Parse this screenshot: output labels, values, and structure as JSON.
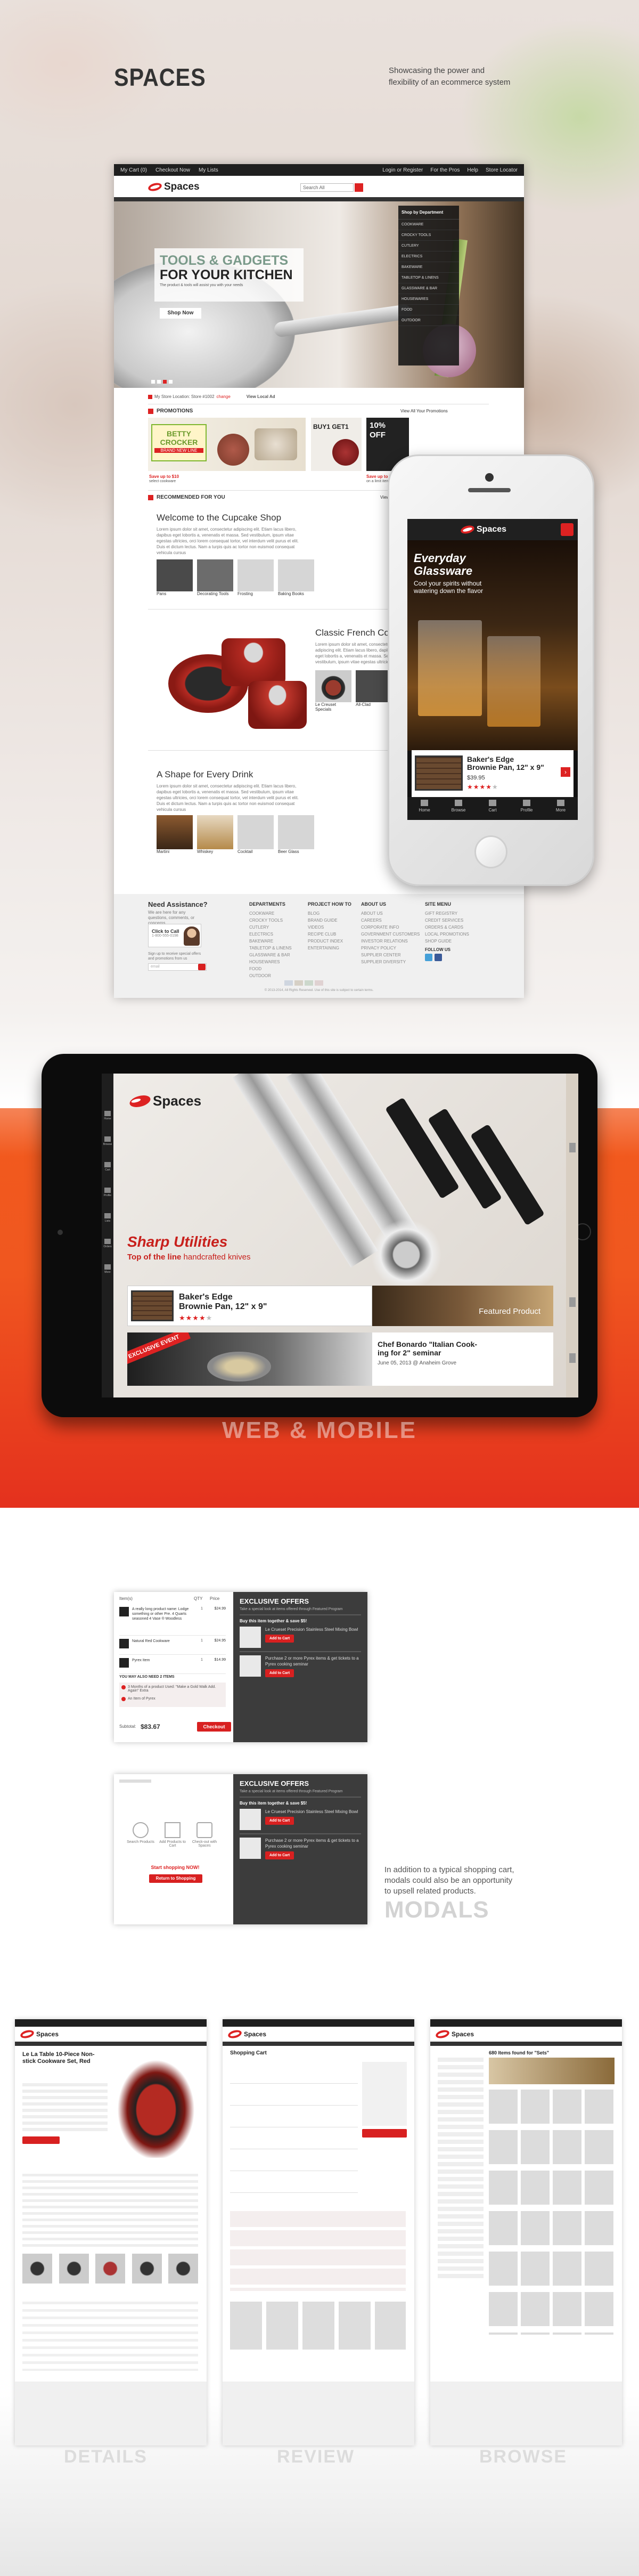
{
  "intro": {
    "title": "SPACES",
    "tagline_line1": "Showcasing the power and",
    "tagline_line2": "flexibility of an ecommerce system"
  },
  "desktop": {
    "top_nav": {
      "cart": "My Cart (0)",
      "checkout": "Checkout Now",
      "lists": "My Lists",
      "login": "Login or Register",
      "pros": "For the Pros",
      "help": "Help",
      "store": "Store Locator"
    },
    "logo": "Spaces",
    "search_placeholder": "Search All",
    "hero": {
      "heading_line1": "TOOLS & GADGETS",
      "heading_line2": "FOR YOUR KITCHEN",
      "subtext": "The product & tools will assist you with your needs",
      "button": "Shop Now"
    },
    "departments": {
      "header": "Shop by Department",
      "items": [
        "COOKWARE",
        "CROCKY TOOLS",
        "CUTLERY",
        "ELECTRICS",
        "BAKEWARE",
        "TABLETOP & LINENS",
        "GLASSWARE & BAR",
        "HOUSEWARES",
        "FOOD",
        "OUTDOOR"
      ]
    },
    "store_bar": {
      "text": "My Store Location: Store #1002",
      "change": "change",
      "local_ad": "View Local Ad"
    },
    "promotions": {
      "label": "PROMOTIONS",
      "view_all": "View All Your Promotions",
      "banner1_line1": "BETTY",
      "banner1_line2": "CROCKER",
      "banner1_line3": "BRAND NEW LINE",
      "banner2": "BUY1 GET1",
      "banner3_line1": "10%",
      "banner3_line2": "OFF",
      "save1_title": "Save up to $10",
      "save1_sub": "select cookware",
      "save2_title": "Save up to $20",
      "save2_sub": "on a limit item"
    },
    "recommended": {
      "label": "RECOMMENDED FOR YOU",
      "view": "View"
    },
    "cupcake": {
      "title": "Welcome to the Cupcake Shop",
      "body": "Lorem ipsum dolor sit amet, consectetur adipiscing elit. Etiam lacus libero, dapibus eget lobortis a, venenatis et massa. Sed vestibulum, ipsum vitae egestas ultricies, orci lorem consequat tortor, vel interdum velit purus et elit. Duis et dictum lectus. Nam a turpis quis ac tortor non euismod consequat vehicula cursus",
      "captions": [
        "Pans",
        "Decorating Tools",
        "Frosting",
        "Baking Books"
      ]
    },
    "french": {
      "title": "Classic French Co",
      "body": "Lorem ipsum dolor sit amet, consectetur adipiscing elit. Etiam lacus libero, dapibus eget lobortis a, venenatis et massa. Sed vestibulum, ipsum vitae egestas ultricies",
      "captions": [
        "Le Creuset Specials",
        "All-Clad"
      ]
    },
    "drink": {
      "title": "A Shape for Every Drink",
      "body": "Lorem ipsum dolor sit amet, consectetur adipiscing elit. Etiam lacus libero, dapibus eget lobortis a, venenatis et massa. Sed vestibulum, ipsum vitae egestas ultricies, orci lorem consequat tortor, vel interdum velit purus et elit. Duis et dictum lectus. Nam a turpis quis ac tortor non euismod consequat vehicula cursus",
      "captions": [
        "Martini",
        "Whiskey",
        "Cocktail",
        "Beer Glass"
      ]
    },
    "footer": {
      "assist_title": "Need Assistance?",
      "assist_text": "We are here for any questions, comments, or concerns",
      "call_label": "Click to Call",
      "call_number": "1-800-555-0198",
      "signup_text": "Sign up to receive special offers and promotions from us",
      "email_placeholder": "email",
      "columns": [
        {
          "title": "DEPARTMENTS",
          "items": [
            "COOKWARE",
            "CROCKY TOOLS",
            "CUTLERY",
            "ELECTRICS",
            "BAKEWARE",
            "TABLETOP & LINENS",
            "GLASSWARE & BAR",
            "HOUSEWARES",
            "FOOD",
            "OUTDOOR"
          ]
        },
        {
          "title": "PROJECT HOW TO",
          "items": [
            "BLOG",
            "BRAND GUIDE",
            "VIDEOS",
            "RECIPE CLUB",
            "PRODUCT INDEX",
            "ENTERTAINING"
          ]
        },
        {
          "title": "ABOUT US",
          "items": [
            "ABOUT US",
            "CAREERS",
            "CORPORATE INFO",
            "GOVERNMENT CUSTOMERS",
            "INVESTOR RELATIONS",
            "PRIVACY POLICY",
            "SUPPLIER CENTER",
            "SUPPLIER DIVERSITY"
          ]
        },
        {
          "title": "SITE MENU",
          "items": [
            "GIFT REGISTRY",
            "CREDIT SERVICES",
            "ORDERS & CARDS",
            "LOCAL PROMOTIONS",
            "SHOP GUIDE"
          ]
        }
      ],
      "follow": "FOLLOW US",
      "copyright": "© 2013-2014, All Rights Reserved. Use of this site is subject to certain terms."
    }
  },
  "phone": {
    "logo": "Spaces",
    "hero_title_line1": "Everyday",
    "hero_title_line2": "Glassware",
    "hero_sub_line1": "Cool your spirits without",
    "hero_sub_line2": "watering down the flavor",
    "product_title_line1": "Baker's Edge",
    "product_title_line2": "Brownie Pan, 12\" x 9\"",
    "price": "$39.95",
    "stars": 4,
    "tabs": [
      "Home",
      "Browse",
      "Cart",
      "Profile",
      "More"
    ]
  },
  "tablet": {
    "logo": "Spaces",
    "hero_title": "Sharp Utilities",
    "hero_sub_prefix": "Top of the line",
    "hero_sub_suffix": "handcrafted knives",
    "product_title_line1": "Baker's Edge",
    "product_title_line2": "Brownie Pan, 12\" x 9\"",
    "featured": "Featured Product",
    "event_badge": "EXCLUSIVE EVENT",
    "event_title_line1": "Chef Bonardo \"Italian Cook-",
    "event_title_line2": "ing for 2\" seminar",
    "event_date": "June 05, 2013 @ Anaheim Grove",
    "sidebar": [
      "Home",
      "Browse",
      "Cart",
      "Profile",
      "Lists",
      "Orders",
      "More"
    ]
  },
  "web_mobile_label": "WEB & MOBILE",
  "modals": {
    "cart": {
      "headers": [
        "Item(s)",
        "QTY",
        "Price"
      ],
      "items": [
        {
          "name": "A really long product name: Lodge something or other Pre. 4 Quarts seasoned 4 Vase ® Woodless",
          "price": "$24.99",
          "qty": "1"
        },
        {
          "name": "Natural Red Cookware",
          "price": "$24.95",
          "qty": "1"
        },
        {
          "name": "Pyrex Item",
          "price": "$14.99",
          "qty": "1"
        }
      ],
      "may_need": "YOU MAY ALSO NEED 2 ITEMS",
      "need_items": [
        "3 Months of a product Used: \"Make a Gold Walk Add. Again\" Extra",
        "An Item of Pyrex"
      ],
      "subtotal_label": "Subtotal:",
      "subtotal": "$83.67",
      "checkout": "Checkout"
    },
    "offers": {
      "title": "EXCLUSIVE OFFERS",
      "sub": "Take a special look at items offered through Featured Program",
      "offer1": "Buy this item together & save $5!",
      "offer1_sub": "Le Crueset Precision Stainless Steel Mixing Bowl",
      "offer2": "Purchase 2 or more Pyrex items & get tickets to a Pyrex cooking seminar",
      "add": "Add to Cart"
    },
    "empty": {
      "steps": [
        "Search Products",
        "Add Products to Cart",
        "Check-out with Spaces"
      ],
      "cta": "Start shopping NOW!",
      "button": "Return to Shopping"
    },
    "description_line1": "In addition to a typical shopping cart,",
    "description_line2": "modals could also be an opportunity",
    "description_line3": "to upsell related products.",
    "label": "MODALS"
  },
  "bottom": {
    "logo": "Spaces",
    "details_title": "Le La Table 10-Piece Non-stick Cookware Set, Red",
    "review_title": "Shopping Cart",
    "browse_title": "680 Items found for \"Sets\"",
    "labels": [
      "DETAILS",
      "REVIEW",
      "BROWSE"
    ]
  }
}
